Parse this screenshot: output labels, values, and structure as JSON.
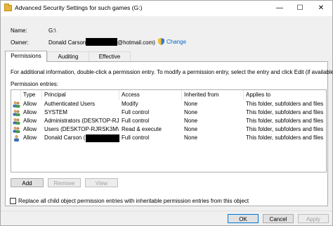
{
  "window": {
    "title": "Advanced Security Settings for such games (G:)",
    "min_glyph": "—",
    "max_glyph": "☐",
    "close_glyph": "✕"
  },
  "info": {
    "name_label": "Name:",
    "name_value": "G:\\",
    "owner_label": "Owner:",
    "owner_name": "Donald Carson",
    "owner_email_suffix": "@hotmail.com)",
    "change_link": "Change"
  },
  "tabs": [
    {
      "label": "Permissions",
      "active": true
    },
    {
      "label": "Auditing",
      "active": false
    },
    {
      "label": "Effective Access",
      "active": false
    }
  ],
  "permissions": {
    "info_text": "For additional information, double-click a permission entry. To modify a permission entry, select the entry and click Edit (if available).",
    "entries_label": "Permission entries:",
    "columns": [
      "Type",
      "Principal",
      "Access",
      "Inherited from",
      "Applies to"
    ],
    "rows": [
      {
        "type": "Allow",
        "principal": "Authenticated Users",
        "access": "Modify",
        "inherited": "None",
        "applies": "This folder, subfolders and files",
        "icon": "group-users-icon"
      },
      {
        "type": "Allow",
        "principal": "SYSTEM",
        "access": "Full control",
        "inherited": "None",
        "applies": "This folder, subfolders and files",
        "icon": "group-users-icon"
      },
      {
        "type": "Allow",
        "principal": "Administrators (DESKTOP-RJR...",
        "access": "Full control",
        "inherited": "None",
        "applies": "This folder, subfolders and files",
        "icon": "group-users-icon"
      },
      {
        "type": "Allow",
        "principal": "Users (DESKTOP-RJRSK3M\\Use...",
        "access": "Read & execute",
        "inherited": "None",
        "applies": "This folder, subfolders and files",
        "icon": "group-users-icon"
      },
      {
        "type": "Allow",
        "principal": "Donald Carson (",
        "access": "Full control",
        "inherited": "None",
        "applies": "This folder, subfolders and files",
        "icon": "single-user-icon"
      }
    ],
    "add_label": "Add",
    "remove_label": "Remove",
    "view_label": "View",
    "replace_checkbox_label": "Replace all child object permission entries with inheritable permission entries from this object"
  },
  "footer": {
    "ok_label": "OK",
    "cancel_label": "Cancel",
    "apply_label": "Apply"
  },
  "colors": {
    "link": "#0066cc",
    "selected_tab_bg": "#ffffff",
    "primary_button_border": "#0078d7"
  }
}
